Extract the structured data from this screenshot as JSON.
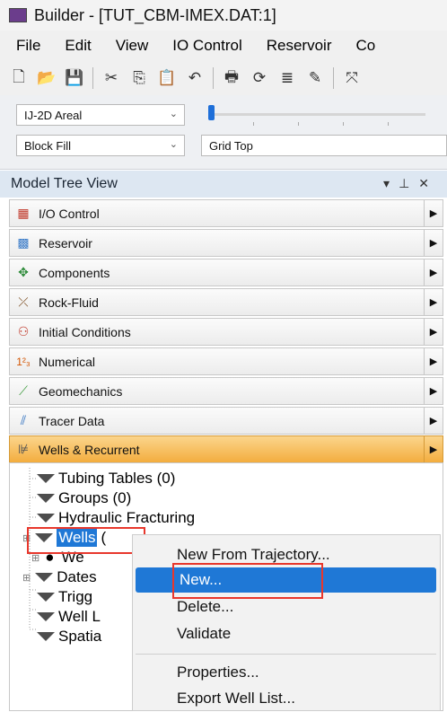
{
  "window": {
    "title": "Builder - [TUT_CBM-IMEX.DAT:1]"
  },
  "menu": [
    "File",
    "Edit",
    "View",
    "IO Control",
    "Reservoir",
    "Co"
  ],
  "toolbar_icons": [
    "new-icon",
    "open-icon",
    "save-icon",
    "cut-icon",
    "copy-icon",
    "paste-icon",
    "undo-icon",
    "print-icon",
    "refresh-icon",
    "align-icon",
    "draw-icon",
    "expand-icon"
  ],
  "options": {
    "view_combo": "IJ-2D Areal",
    "fill_combo": "Block Fill",
    "layer_field": "Grid Top"
  },
  "model_tree": {
    "title": "Model Tree View",
    "controls": [
      "▾",
      "⊥",
      "✕"
    ],
    "sections": [
      {
        "label": "I/O Control",
        "icon": "io-control-icon"
      },
      {
        "label": "Reservoir",
        "icon": "reservoir-icon"
      },
      {
        "label": "Components",
        "icon": "components-icon"
      },
      {
        "label": "Rock-Fluid",
        "icon": "rock-fluid-icon"
      },
      {
        "label": "Initial Conditions",
        "icon": "initial-conditions-icon"
      },
      {
        "label": "Numerical",
        "icon": "numerical-icon"
      },
      {
        "label": "Geomechanics",
        "icon": "geomechanics-icon"
      },
      {
        "label": "Tracer Data",
        "icon": "tracer-data-icon"
      },
      {
        "label": "Wells & Recurrent",
        "icon": "wells-recurrent-icon",
        "active": true
      }
    ],
    "tree_items": {
      "tubing": "Tubing Tables (0)",
      "groups": "Groups (0)",
      "hydraulic": "Hydraulic Fracturing",
      "wells": "Wells",
      "wells_suffix": "(",
      "well_child": "We",
      "dates": "Dates",
      "triggers": "Trigg",
      "well_lists": "Well L",
      "spatial": "Spatia"
    }
  },
  "context_menu": {
    "items": [
      "New From Trajectory...",
      "New...",
      "Delete...",
      "Validate",
      "Properties...",
      "Export Well List..."
    ],
    "selected": "New..."
  },
  "colors": {
    "accent": "#1f78d6",
    "highlight_box": "#e8372c",
    "active_section": "#f3ad3e"
  }
}
